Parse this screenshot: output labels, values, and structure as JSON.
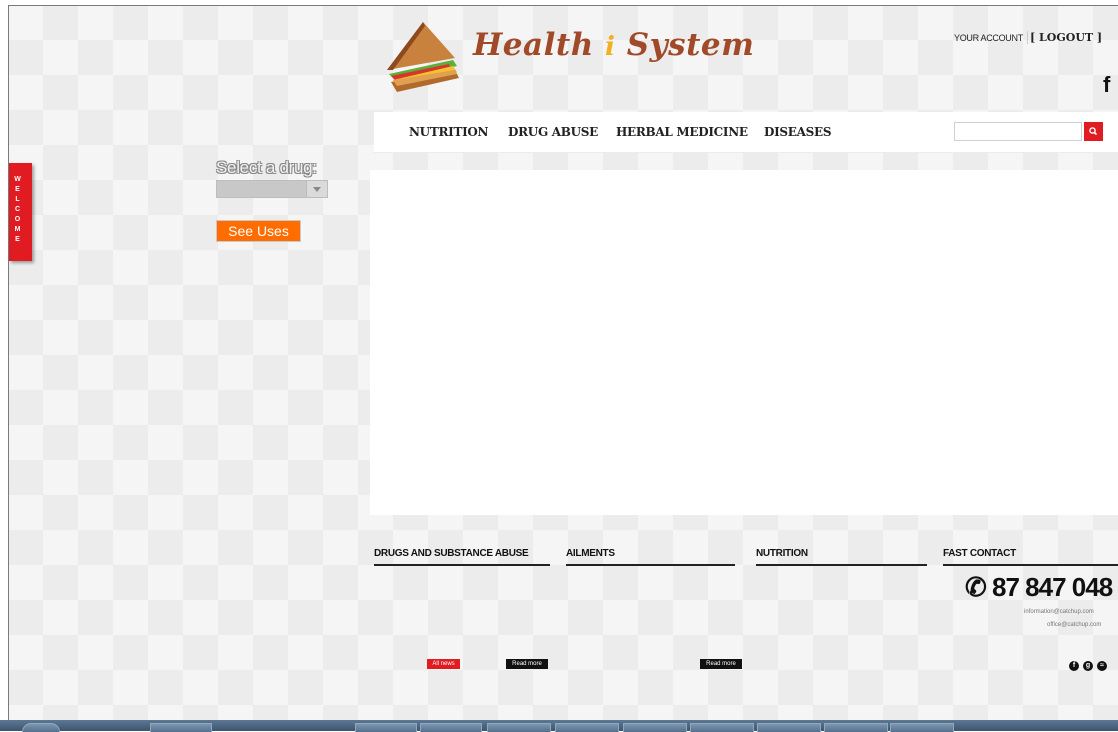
{
  "brand": {
    "title": "Health",
    "connector": "i",
    "title_suffix": "System"
  },
  "account": {
    "your_account": "YOUR ACCOUNT",
    "logout": "[ LOGOUT ]",
    "social_icon": "f"
  },
  "nav": {
    "items": [
      {
        "label": "NUTRITION"
      },
      {
        "label": "DRUG ABUSE"
      },
      {
        "label": "HERBAL MEDICINE"
      },
      {
        "label": "DISEASES"
      }
    ]
  },
  "search": {
    "value": "",
    "icon": "search-icon"
  },
  "welcome": {
    "letters": [
      "W",
      "E",
      "L",
      "C",
      "O",
      "M",
      "E"
    ]
  },
  "drug_form": {
    "label": "Select a drug:",
    "selected": "",
    "button": "See Uses"
  },
  "footer": {
    "columns": [
      {
        "title": "DRUGS AND SUBSTANCE ABUSE"
      },
      {
        "title": "AILMENTS"
      },
      {
        "title": "NUTRITION"
      },
      {
        "title": "FAST CONTACT"
      }
    ],
    "phone": "87 847 048",
    "emails": [
      "information@catchup.com",
      "office@catchup.com"
    ],
    "badges": {
      "all_news": "All news",
      "read_more_1": "Read more",
      "read_more_2": "Read more"
    },
    "social_icons": [
      "facebook-icon",
      "google-icon",
      "rss-icon"
    ]
  },
  "colors": {
    "accent_red": "#e11b22",
    "button_orange": "#ff6d00",
    "brand_brown": "#a04a2a"
  }
}
